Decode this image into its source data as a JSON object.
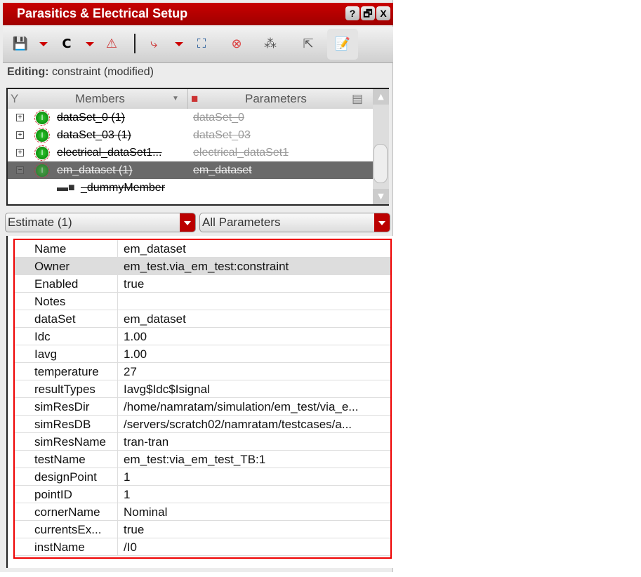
{
  "window": {
    "title": "Parasitics & Electrical Setup",
    "help": "?",
    "restore": "🗗",
    "close": "X"
  },
  "toolbar": {
    "c_label": "C"
  },
  "editing": {
    "label": "Editing:",
    "value": "constraint (modified)"
  },
  "tree": {
    "col_members": "Members",
    "col_parameters": "Parameters",
    "rows": [
      {
        "member": "dataSet_0 (1)",
        "param": "dataSet_0"
      },
      {
        "member": "dataSet_03 (1)",
        "param": "dataSet_03"
      },
      {
        "member": "electrical_dataSet1...",
        "param": "electrical_dataSet1"
      },
      {
        "member": "em_dataset (1)",
        "param": "em_dataset"
      }
    ],
    "child": "_dummyMember"
  },
  "filters": {
    "estimate": "Estimate (1)",
    "parameters": "All Parameters"
  },
  "properties": [
    {
      "k": "Name",
      "v": "em_dataset"
    },
    {
      "k": "Owner",
      "v": "em_test.via_em_test:constraint"
    },
    {
      "k": "Enabled",
      "v": "true"
    },
    {
      "k": "Notes",
      "v": ""
    },
    {
      "k": "dataSet",
      "v": "em_dataset"
    },
    {
      "k": "Idc",
      "v": "1.00"
    },
    {
      "k": "Iavg",
      "v": "1.00"
    },
    {
      "k": "temperature",
      "v": "27"
    },
    {
      "k": "resultTypes",
      "v": "Iavg$Idc$Isignal"
    },
    {
      "k": "simResDir",
      "v": "/home/namratam/simulation/em_test/via_e..."
    },
    {
      "k": "simResDB",
      "v": "/servers/scratch02/namratam/testcases/a..."
    },
    {
      "k": "simResName",
      "v": "tran-tran"
    },
    {
      "k": "testName",
      "v": "em_test:via_em_test_TB:1"
    },
    {
      "k": "designPoint",
      "v": "1"
    },
    {
      "k": "pointID",
      "v": "1"
    },
    {
      "k": "cornerName",
      "v": "Nominal"
    },
    {
      "k": "currentsEx...",
      "v": "true"
    },
    {
      "k": "instName",
      "v": "/I0"
    }
  ]
}
